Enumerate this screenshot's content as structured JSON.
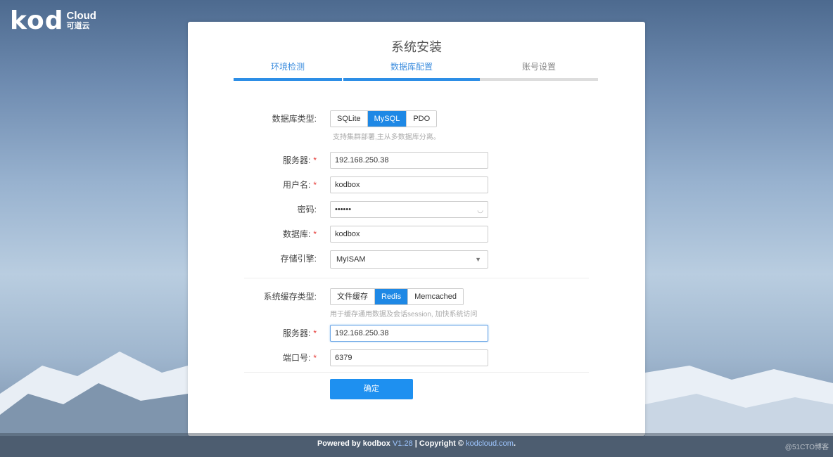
{
  "logo": {
    "main": "kod",
    "cloud": "Cloud",
    "cn": "可道云"
  },
  "page": {
    "title": "系统安装"
  },
  "steps": [
    {
      "label": "环境检测",
      "state": "done"
    },
    {
      "label": "数据库配置",
      "state": "active"
    },
    {
      "label": "账号设置",
      "state": "pending"
    }
  ],
  "db": {
    "type_label": "数据库类型:",
    "type_options": [
      "SQLite",
      "MySQL",
      "PDO"
    ],
    "type_selected": "MySQL",
    "type_hint": "支持集群部署,主从多数据库分离。",
    "server_label": "服务器:",
    "server_value": "192.168.250.38",
    "user_label": "用户名:",
    "user_value": "kodbox",
    "password_label": "密码:",
    "password_value": "••••••",
    "database_label": "数据库:",
    "database_value": "kodbox",
    "engine_label": "存储引擎:",
    "engine_value": "MyISAM"
  },
  "cache": {
    "type_label": "系统缓存类型:",
    "type_options": [
      "文件缓存",
      "Redis",
      "Memcached"
    ],
    "type_selected": "Redis",
    "type_hint": "用于缓存通用数据及会话session, 加快系统访问",
    "server_label": "服务器:",
    "server_value": "192.168.250.38",
    "port_label": "端口号:",
    "port_value": "6379"
  },
  "submit_label": "确定",
  "required_mark": "*",
  "footer": {
    "powered": "Powered by kodbox",
    "version": "V1.28",
    "sep": "|",
    "copyright": "Copyright ©",
    "site": "kodcloud.com",
    "dot": "."
  },
  "watermark": "@51CTO博客",
  "colors": {
    "accent": "#1e88e5",
    "required": "#e53935"
  }
}
